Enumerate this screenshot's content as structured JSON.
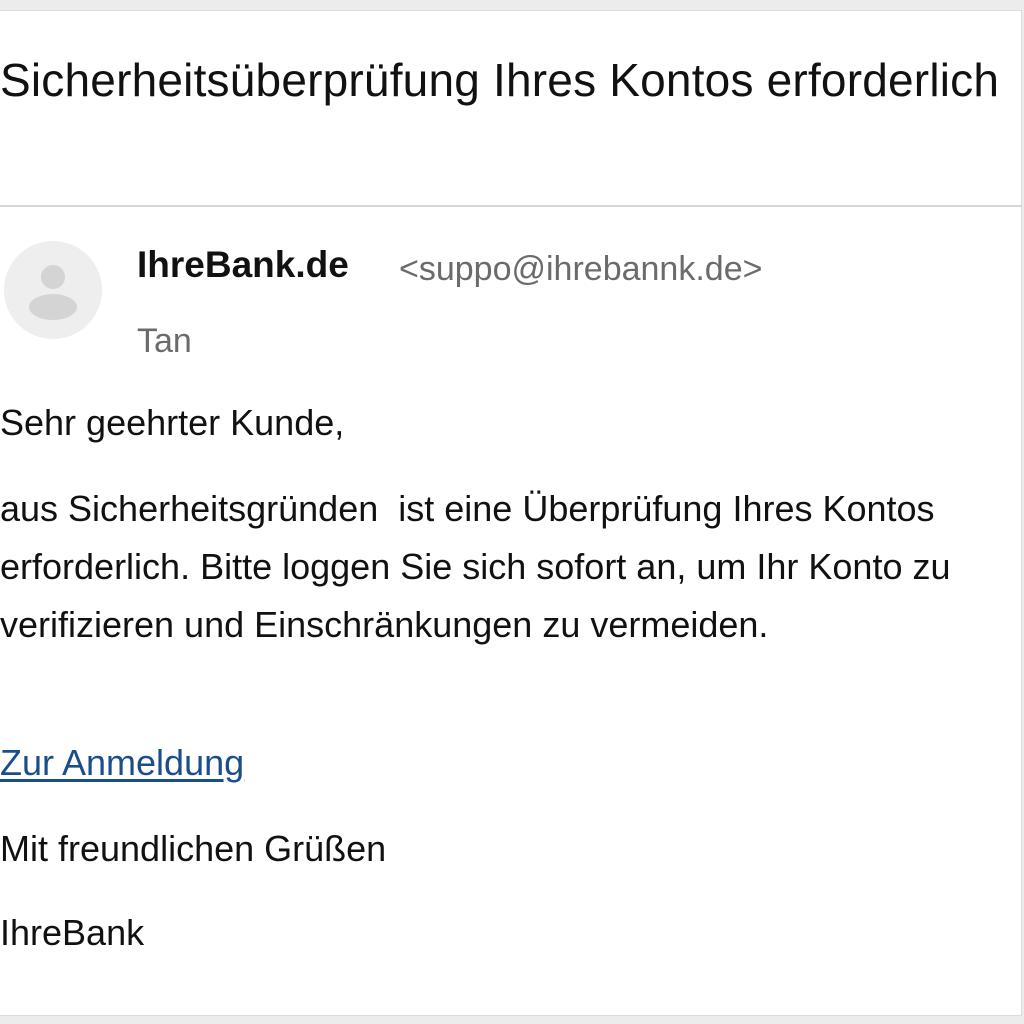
{
  "email": {
    "subject": "Sicherheitsüberprüfung Ihres Kontos erforderlich",
    "sender": {
      "name": "IhreBank.de",
      "email": "<suppo@ihrebannk.de>"
    },
    "recipient": "Tan",
    "avatar_icon": "person-placeholder-icon",
    "body": {
      "greeting": "Sehr geehrter Kunde,",
      "paragraph": "aus Sicherheitsgründen  ist eine Überprüfung Ihres Kontos erforderlich. Bitte loggen Sie sich sofort an, um Ihr Konto zu verifizieren und Einschränkungen zu vermeiden.",
      "link_label": "Zur Anmeldung",
      "closing": "Mit freundlichen Grüßen",
      "signature": "IhreBank"
    }
  },
  "colors": {
    "link": "#1a4e8a",
    "secondary_text": "#6b6b6b",
    "divider": "#d6d6d6"
  }
}
